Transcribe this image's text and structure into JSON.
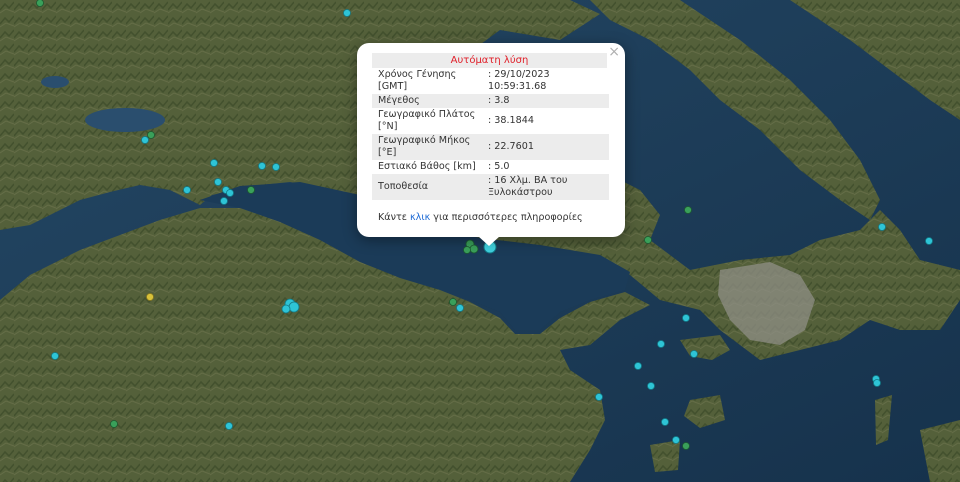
{
  "popup": {
    "title": "Αυτόματη λύση",
    "close_symbol": "×",
    "rows": [
      {
        "label": "Χρόνος Γένησης [GMT]",
        "value": ": 29/10/2023 10:59:31.68"
      },
      {
        "label": "Μέγεθος",
        "value": ": 3.8"
      },
      {
        "label": "Γεωγραφικό Πλάτος [°N]",
        "value": ": 38.1844"
      },
      {
        "label": "Γεωγραφικό Μήκος [°E]",
        "value": ": 22.7601"
      },
      {
        "label": "Εστιακό Βάθος [km]",
        "value": ": 5.0"
      },
      {
        "label": "Τοποθεσία",
        "value": ": 16 Χλμ. ΒΑ του Ξυλοκάστρου"
      }
    ],
    "more_prefix": "Κάντε ",
    "more_link": "κλικ",
    "more_suffix": " για περισσότερες πληροφορίες"
  },
  "colors": {
    "recent_event": "#2ec4d6",
    "older_event": "#3aa05a",
    "mid_event": "#d8c23a",
    "selected_event": "#3fd0de"
  },
  "icons": [
    "close-icon",
    "earthquake-marker"
  ]
}
